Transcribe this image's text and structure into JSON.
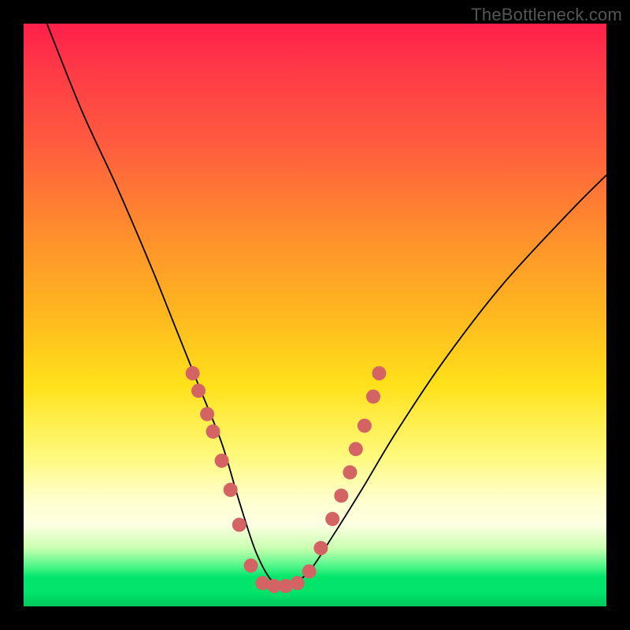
{
  "watermark": "TheBottleneck.com",
  "colors": {
    "dot": "#d46464",
    "curve": "#000000",
    "frame": "#000000"
  },
  "chart_data": {
    "type": "line",
    "title": "",
    "xlabel": "",
    "ylabel": "",
    "xlim": [
      0,
      100
    ],
    "ylim": [
      0,
      100
    ],
    "grid": false,
    "legend": false,
    "series": [
      {
        "name": "bottleneck-curve",
        "description": "V-shaped bottleneck curve (higher = worse, min near x≈43).",
        "x": [
          4,
          10,
          16,
          22,
          26,
          30,
          34,
          37,
          40,
          43,
          46,
          49,
          53,
          58,
          64,
          72,
          82,
          94,
          100
        ],
        "y": [
          100,
          85,
          72,
          58,
          48,
          38,
          28,
          18,
          9,
          4,
          4,
          6,
          12,
          20,
          30,
          42,
          55,
          68,
          74
        ]
      }
    ],
    "markers": {
      "description": "Highlighted sample points along the curve (salmon dots).",
      "points": [
        {
          "x": 29,
          "y": 40
        },
        {
          "x": 30,
          "y": 37
        },
        {
          "x": 31.5,
          "y": 33
        },
        {
          "x": 32.5,
          "y": 30
        },
        {
          "x": 34,
          "y": 25
        },
        {
          "x": 35.5,
          "y": 20
        },
        {
          "x": 37,
          "y": 14
        },
        {
          "x": 39,
          "y": 7
        },
        {
          "x": 41,
          "y": 4
        },
        {
          "x": 43,
          "y": 3.5
        },
        {
          "x": 45,
          "y": 3.5
        },
        {
          "x": 47,
          "y": 4
        },
        {
          "x": 49,
          "y": 6
        },
        {
          "x": 51,
          "y": 10
        },
        {
          "x": 53,
          "y": 15
        },
        {
          "x": 54.5,
          "y": 19
        },
        {
          "x": 56,
          "y": 23
        },
        {
          "x": 57,
          "y": 27
        },
        {
          "x": 58.5,
          "y": 31
        },
        {
          "x": 60,
          "y": 36
        },
        {
          "x": 61,
          "y": 40
        }
      ]
    }
  }
}
